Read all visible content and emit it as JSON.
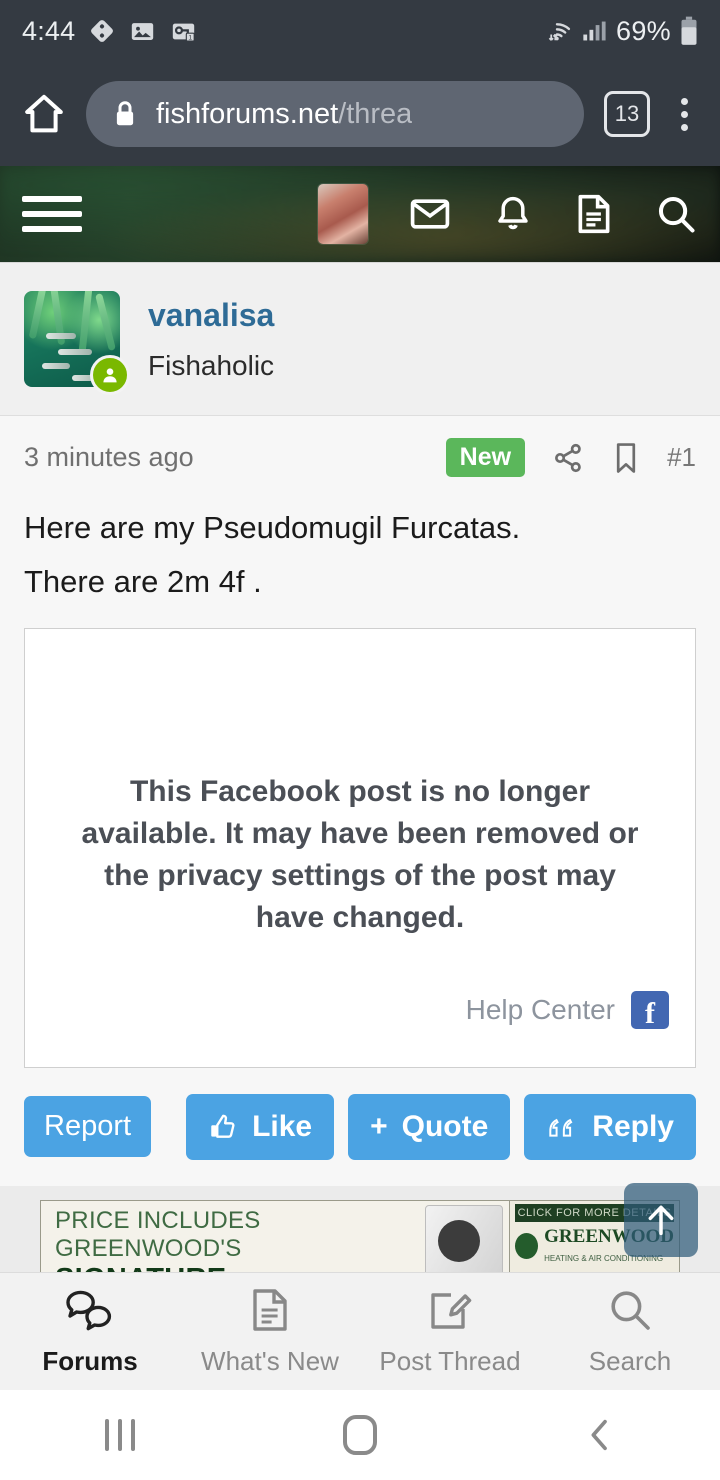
{
  "status_bar": {
    "time": "4:44",
    "battery_percent": "69%",
    "icons": [
      "dice-icon",
      "gallery-icon",
      "badge-one-icon",
      "wifi-icon",
      "cell-signal-icon",
      "battery-icon"
    ]
  },
  "browser": {
    "url_domain": "fishforums.net",
    "url_path": "/threa",
    "tab_count": "13",
    "icons": [
      "home-icon",
      "lock-icon",
      "tabs-icon",
      "overflow-menu-icon"
    ]
  },
  "forum_nav": {
    "icons": [
      "hamburger-menu-icon",
      "user-avatar-thumb",
      "inbox-icon",
      "alerts-bell-icon",
      "pages-icon",
      "search-icon"
    ]
  },
  "post": {
    "author": "vanalisa",
    "author_title": "Fishaholic",
    "timestamp": "3 minutes ago",
    "new_badge": "New",
    "post_number": "#1",
    "body_lines": [
      "Here are my Pseudomugil Furcatas.",
      "There are 2m 4f ."
    ]
  },
  "embed": {
    "message": "This Facebook post is no longer available. It may have been removed or the privacy settings of the post may have changed.",
    "help_center": "Help Center",
    "brand": "f"
  },
  "actions": {
    "report": "Report",
    "like": "Like",
    "quote": "Quote",
    "quote_prefix": "+",
    "reply": "Reply"
  },
  "ad": {
    "line1": "PRICE INCLUDES GREENWOOD'S",
    "line2": "SIGNATURE INSTALLATION",
    "cta": "CLICK FOR MORE DETAILS",
    "brand": "GREENWOOD",
    "brand_sub": "HEATING & AIR CONDITIONING"
  },
  "bottom_nav": {
    "items": [
      {
        "label": "Forums",
        "icon": "forums-chat-icon"
      },
      {
        "label": "What's New",
        "icon": "document-icon"
      },
      {
        "label": "Post Thread",
        "icon": "compose-pencil-icon"
      },
      {
        "label": "Search",
        "icon": "search-icon"
      }
    ]
  },
  "colors": {
    "accent_blue": "#4ba3e3",
    "new_green": "#5bb75b",
    "username_blue": "#2e6b96",
    "status_bg": "#343a42"
  }
}
